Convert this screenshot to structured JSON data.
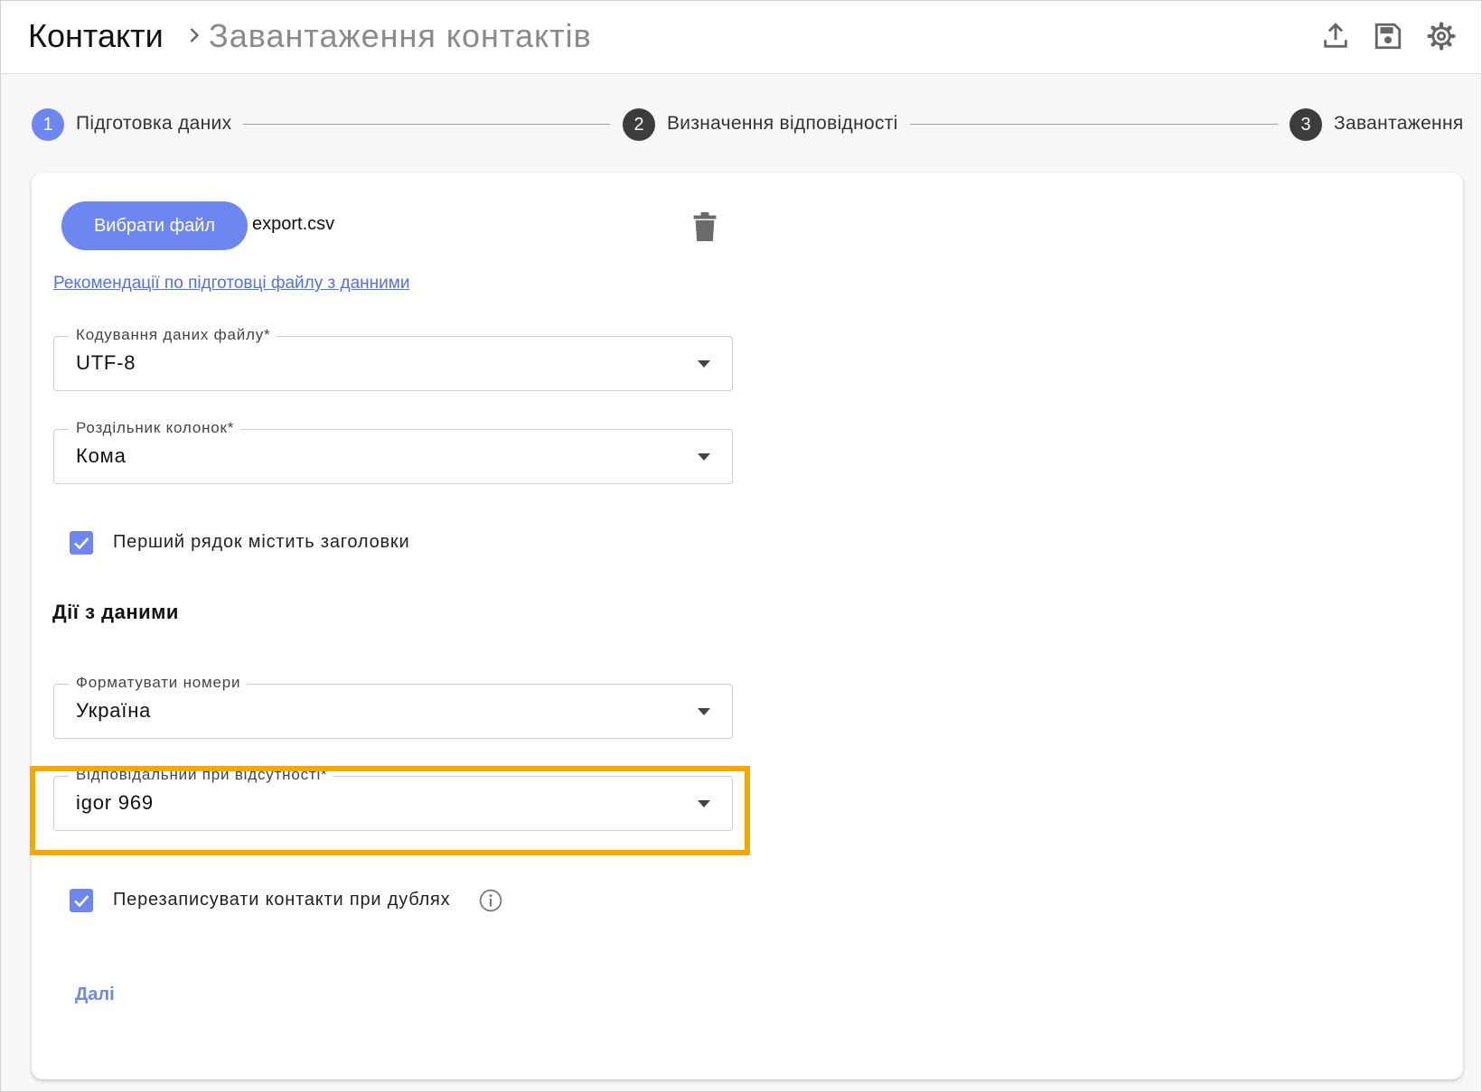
{
  "header": {
    "breadcrumb_root": "Контакти",
    "breadcrumb_current": "Завантаження контактів",
    "icons": [
      "upload-icon",
      "save-icon",
      "gear-icon"
    ]
  },
  "stepper": {
    "steps": [
      {
        "number": "1",
        "label": "Підготовка даних",
        "state": "active"
      },
      {
        "number": "2",
        "label": "Визначення відповідності",
        "state": "pending"
      },
      {
        "number": "3",
        "label": "Завантаження",
        "state": "pending"
      }
    ]
  },
  "file": {
    "choose_button": "Вибрати файл",
    "file_name": "export.csv",
    "recommendations_link": "Рекомендації по підготовці файлу з данними"
  },
  "fields": {
    "encoding": {
      "label": "Кодування даних файлу*",
      "value": "UTF-8"
    },
    "delimiter": {
      "label": "Роздільник колонок*",
      "value": "Кома"
    },
    "phone_format": {
      "label": "Форматувати номери",
      "value": "Україна"
    },
    "responsible": {
      "label": "Відповідальний при відсутності*",
      "value": "igor 969"
    }
  },
  "options": {
    "first_row_headers": {
      "label": "Перший рядок містить заголовки",
      "checked": true
    },
    "overwrite_duplicates": {
      "label": "Перезаписувати контакти при дублях",
      "checked": true
    }
  },
  "section": {
    "title": "Дії з даними"
  },
  "actions": {
    "next_label": "Далі"
  },
  "colors": {
    "accent": "#6e86f0",
    "step_inactive": "#3c3c3c",
    "highlight": "#f5a800",
    "link": "#5470e6"
  }
}
